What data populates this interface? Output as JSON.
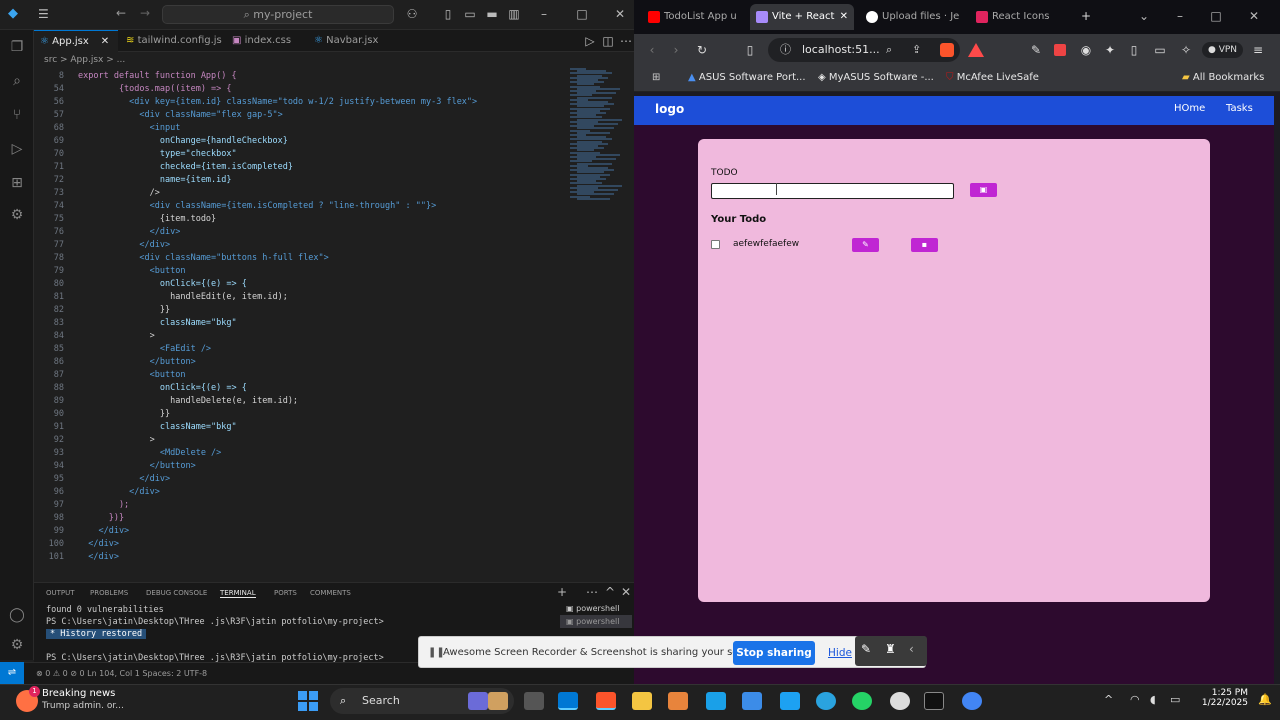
{
  "vscode": {
    "search_text": "my-project",
    "tabs": [
      {
        "label": "App.jsx",
        "color": "#3ba5f0"
      },
      {
        "label": "tailwind.config.js",
        "color": "#f5de19"
      },
      {
        "label": "index.css",
        "color": "#c586c0"
      },
      {
        "label": "Navbar.jsx",
        "color": "#3ba5f0"
      }
    ],
    "breadcrumb": "src > App.jsx > ...",
    "code_lines": [
      {
        "n": "8",
        "t": "export default function App() {"
      },
      {
        "n": "54",
        "t": "        {todos.map((item) => {"
      },
      {
        "n": "56",
        "t": "          <div key={item.id} className=\"todo w-1/2 justify-between my-3 flex\">"
      },
      {
        "n": "57",
        "t": "            <div className=\"flex gap-5\">"
      },
      {
        "n": "68",
        "t": "              <input"
      },
      {
        "n": "69",
        "t": "                onChange={handleCheckbox}"
      },
      {
        "n": "70",
        "t": "                type=\"checkbox\""
      },
      {
        "n": "71",
        "t": "                checked={item.isCompleted}"
      },
      {
        "n": "72",
        "t": "                name={item.id}"
      },
      {
        "n": "73",
        "t": "              />"
      },
      {
        "n": "74",
        "t": "              <div className={item.isCompleted ? \"line-through\" : \"\"}>"
      },
      {
        "n": "75",
        "t": "                {item.todo}"
      },
      {
        "n": "76",
        "t": "              </div>"
      },
      {
        "n": "77",
        "t": "            </div>"
      },
      {
        "n": "78",
        "t": "            <div className=\"buttons h-full flex\">"
      },
      {
        "n": "79",
        "t": "              <button"
      },
      {
        "n": "80",
        "t": "                onClick={(e) => {"
      },
      {
        "n": "81",
        "t": "                  handleEdit(e, item.id);"
      },
      {
        "n": "82",
        "t": "                }}"
      },
      {
        "n": "83",
        "t": "                className=\"bkg\""
      },
      {
        "n": "84",
        "t": "              >"
      },
      {
        "n": "85",
        "t": "                <FaEdit />"
      },
      {
        "n": "86",
        "t": "              </button>"
      },
      {
        "n": "87",
        "t": "              <button"
      },
      {
        "n": "88",
        "t": "                onClick={(e) => {"
      },
      {
        "n": "89",
        "t": "                  handleDelete(e, item.id);"
      },
      {
        "n": "90",
        "t": "                }}"
      },
      {
        "n": "91",
        "t": "                className=\"bkg\""
      },
      {
        "n": "92",
        "t": "              >"
      },
      {
        "n": "93",
        "t": "                <MdDelete />"
      },
      {
        "n": "94",
        "t": "              </button>"
      },
      {
        "n": "95",
        "t": "            </div>"
      },
      {
        "n": "96",
        "t": "          </div>"
      },
      {
        "n": "97",
        "t": "        );"
      },
      {
        "n": "98",
        "t": "      })}"
      },
      {
        "n": "99",
        "t": "    </div>"
      },
      {
        "n": "100",
        "t": "  </div>"
      },
      {
        "n": "101",
        "t": "  </div>"
      }
    ],
    "panel_tabs": [
      "OUTPUT",
      "PROBLEMS",
      "DEBUG CONSOLE",
      "TERMINAL",
      "PORTS",
      "COMMENTS"
    ],
    "terminal_lines": [
      "found 0 vulnerabilities",
      "PS C:\\Users\\jatin\\Desktop\\THree .js\\R3F\\jatin potfolio\\my-project>",
      "History restored",
      "PS C:\\Users\\jatin\\Desktop\\THree .js\\R3F\\jatin potfolio\\my-project>"
    ],
    "terminal_list": [
      "powershell",
      "powershell"
    ],
    "status": "⊗ 0 ⚠ 0   ⊘ 0        Ln 104, Col 1   Spaces: 2   UTF-8"
  },
  "browser": {
    "tabs": [
      {
        "label": "TodoList App u",
        "color": "#ff0000"
      },
      {
        "label": "Vite + React",
        "color": "#a78bfa"
      },
      {
        "label": "Upload files · Je",
        "color": "#ffffff"
      },
      {
        "label": "React Icons",
        "color": "#e0245e"
      }
    ],
    "url": "localhost:51...",
    "bookmarks": [
      "ASUS Software Port...",
      "MyASUS Software -...",
      "McAfee LiveSafe",
      "All Bookmarks"
    ],
    "vpn": "VPN"
  },
  "app": {
    "logo": "logo",
    "nav": [
      "HOme",
      "Tasks"
    ],
    "todo_label": "TODO",
    "input_value": "",
    "your_todo": "Your Todo",
    "todos": [
      {
        "text": "aefewfefaefew",
        "completed": false
      }
    ],
    "accent": "#c026d3",
    "card_bg": "#f0b9dd"
  },
  "share_bar": {
    "text": "Awesome Screen Recorder & Screenshot is sharing your screen.",
    "stop": "Stop sharing",
    "hide": "Hide"
  },
  "taskbar": {
    "news_title": "Breaking news",
    "news_sub": "Trump admin. or...",
    "news_badge": "1",
    "search": "Search",
    "time": "1:25 PM",
    "date": "1/22/2025"
  }
}
